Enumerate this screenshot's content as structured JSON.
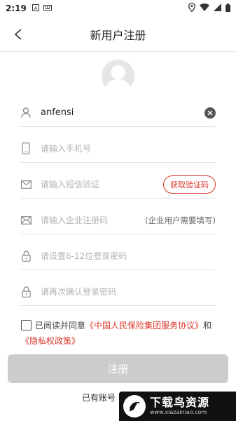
{
  "status_bar": {
    "time": "2:19"
  },
  "header": {
    "title": "新用户注册"
  },
  "form": {
    "username_value": "anfensi",
    "phone_placeholder": "请输入手机号",
    "sms_placeholder": "请输入短信验证",
    "get_code_label": "获取验证码",
    "company_placeholder": "请输入企业注册码",
    "company_note": "(企业用户需要填写)",
    "password_placeholder": "请设置6-12位登录密码",
    "confirm_placeholder": "请再次确认登录密码"
  },
  "agreement": {
    "prefix": "已阅读并同意",
    "service_link": "《中国人民保险集团服务协议》",
    "and": "和",
    "privacy_link": "《隐私权政策》"
  },
  "register_label": "注册",
  "have_account": "已有账号",
  "watermark": {
    "cn": "下载鸟资源",
    "en": "www.xiazainiao.com"
  },
  "colors": {
    "accent": "#d9382b",
    "disabled_button": "#cccccc"
  }
}
